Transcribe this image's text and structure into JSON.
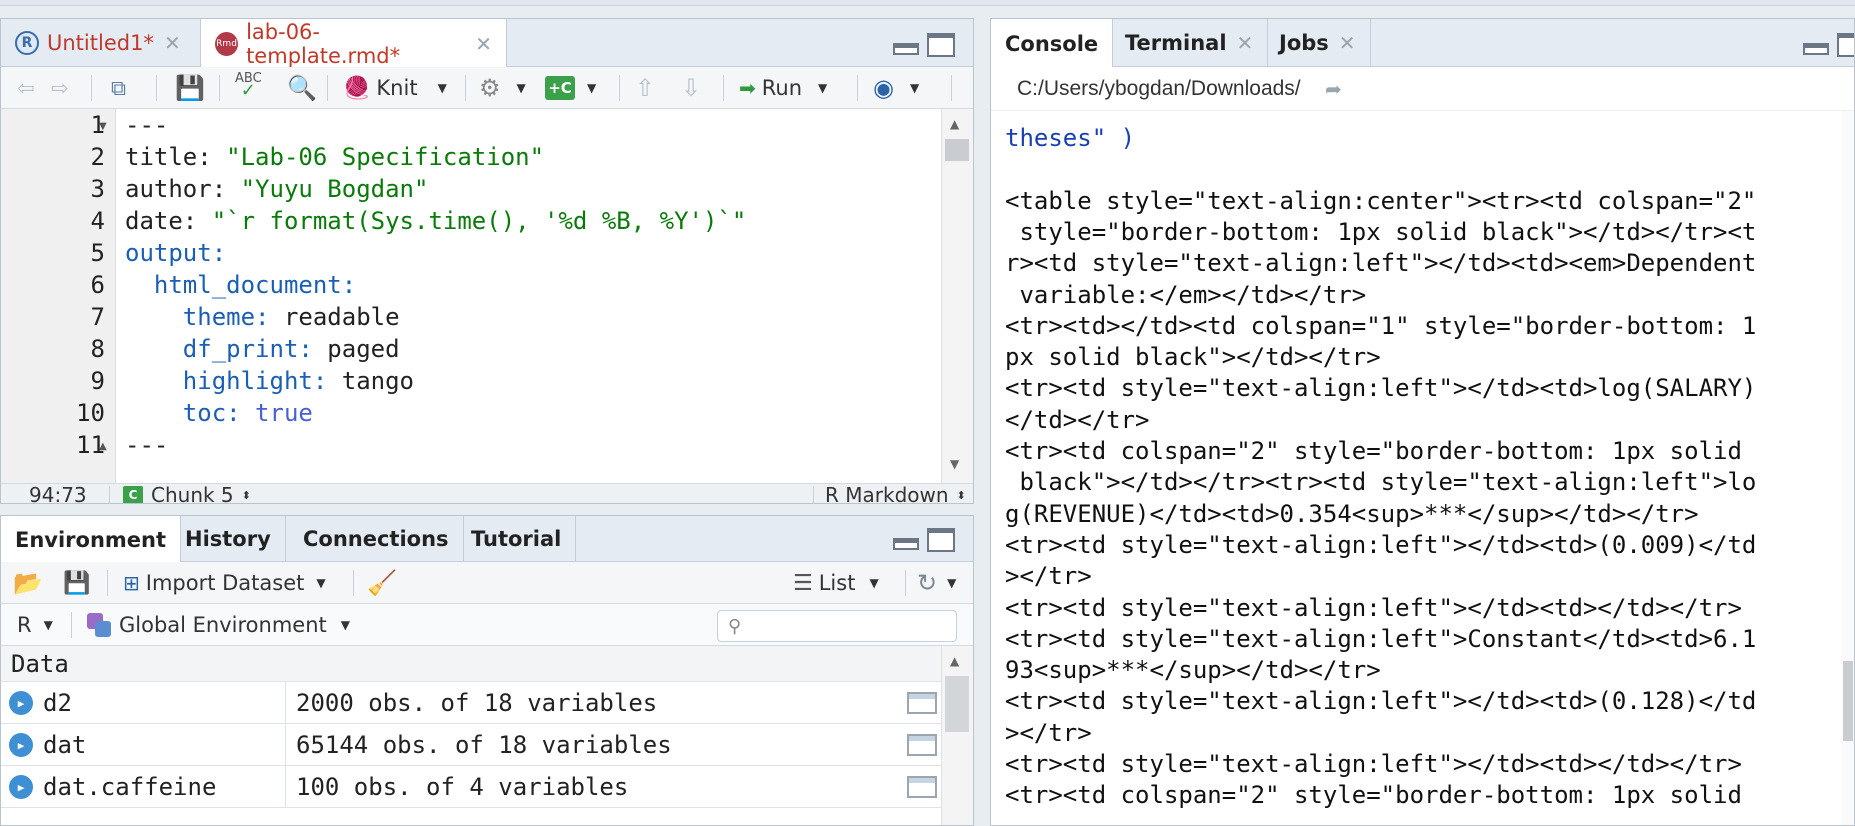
{
  "editor": {
    "tabs": [
      {
        "label": "Untitled1*",
        "icon": "r-file-icon",
        "color": "#c0392b"
      },
      {
        "label": "lab-06-template.rmd*",
        "icon": "rmd-file-icon",
        "color": "#c0392b"
      }
    ],
    "toolbar": {
      "knit_label": "Knit",
      "run_label": "Run"
    },
    "line_numbers": [
      "1",
      "2",
      "3",
      "4",
      "5",
      "6",
      "7",
      "8",
      "9",
      "10",
      "11"
    ],
    "code_lines": [
      {
        "a": "---",
        "b": "",
        "c": ""
      },
      {
        "a": "title: ",
        "b": "\"Lab-06 Specification\"",
        "c": ""
      },
      {
        "a": "author: ",
        "b": "\"Yuyu Bogdan\"",
        "c": ""
      },
      {
        "a": "date: ",
        "b": "\"`r format(Sys.time(), '%d %B, %Y')`\"",
        "c": ""
      },
      {
        "a": "output:",
        "b": "",
        "c": ""
      },
      {
        "a": "  html_document:",
        "b": "",
        "c": ""
      },
      {
        "a": "    theme: ",
        "b": "",
        "c": "readable"
      },
      {
        "a": "    df_print: ",
        "b": "",
        "c": "paged"
      },
      {
        "a": "    highlight: ",
        "b": "",
        "c": "tango"
      },
      {
        "a": "    toc: ",
        "b": "",
        "c": "true"
      },
      {
        "a": "---",
        "b": "",
        "c": ""
      }
    ],
    "status": {
      "position": "94:73",
      "chunk": "Chunk 5",
      "mode": "R Markdown"
    }
  },
  "environment": {
    "tabs": [
      "Environment",
      "History",
      "Connections",
      "Tutorial"
    ],
    "toolbar": {
      "import_label": "Import Dataset",
      "list_label": "List"
    },
    "scope": {
      "lang": "R",
      "env": "Global Environment"
    },
    "search": {
      "placeholder": ""
    },
    "section_header": "Data",
    "rows": [
      {
        "name": "d2",
        "desc": "2000 obs. of 18 variables"
      },
      {
        "name": "dat",
        "desc": "65144 obs. of 18 variables"
      },
      {
        "name": "dat.caffeine",
        "desc": "100 obs. of 4 variables"
      }
    ]
  },
  "console": {
    "tabs": [
      "Console",
      "Terminal",
      "Jobs"
    ],
    "path": "C:/Users/ybogdan/Downloads/",
    "lines": [
      {
        "t": "theses\" )",
        "c": "#1a3fb0"
      },
      {
        "t": "",
        "c": "#111"
      },
      {
        "t": "<table style=\"text-align:center\"><tr><td colspan=\"2\"",
        "c": "#111"
      },
      {
        "t": " style=\"border-bottom: 1px solid black\"></td></tr><t",
        "c": "#111"
      },
      {
        "t": "r><td style=\"text-align:left\"></td><td><em>Dependent",
        "c": "#111"
      },
      {
        "t": " variable:</em></td></tr>",
        "c": "#111"
      },
      {
        "t": "<tr><td></td><td colspan=\"1\" style=\"border-bottom: 1",
        "c": "#111"
      },
      {
        "t": "px solid black\"></td></tr>",
        "c": "#111"
      },
      {
        "t": "<tr><td style=\"text-align:left\"></td><td>log(SALARY)",
        "c": "#111"
      },
      {
        "t": "</td></tr>",
        "c": "#111"
      },
      {
        "t": "<tr><td colspan=\"2\" style=\"border-bottom: 1px solid",
        "c": "#111"
      },
      {
        "t": " black\"></td></tr><tr><td style=\"text-align:left\">lo",
        "c": "#111"
      },
      {
        "t": "g(REVENUE)</td><td>0.354<sup>***</sup></td></tr>",
        "c": "#111"
      },
      {
        "t": "<tr><td style=\"text-align:left\"></td><td>(0.009)</td",
        "c": "#111"
      },
      {
        "t": "></tr>",
        "c": "#111"
      },
      {
        "t": "<tr><td style=\"text-align:left\"></td><td></td></tr>",
        "c": "#111"
      },
      {
        "t": "<tr><td style=\"text-align:left\">Constant</td><td>6.1",
        "c": "#111"
      },
      {
        "t": "93<sup>***</sup></td></tr>",
        "c": "#111"
      },
      {
        "t": "<tr><td style=\"text-align:left\"></td><td>(0.128)</td",
        "c": "#111"
      },
      {
        "t": "></tr>",
        "c": "#111"
      },
      {
        "t": "<tr><td style=\"text-align:left\"></td><td></td></tr>",
        "c": "#111"
      },
      {
        "t": "<tr><td colspan=\"2\" style=\"border-bottom: 1px solid",
        "c": "#111"
      }
    ]
  }
}
